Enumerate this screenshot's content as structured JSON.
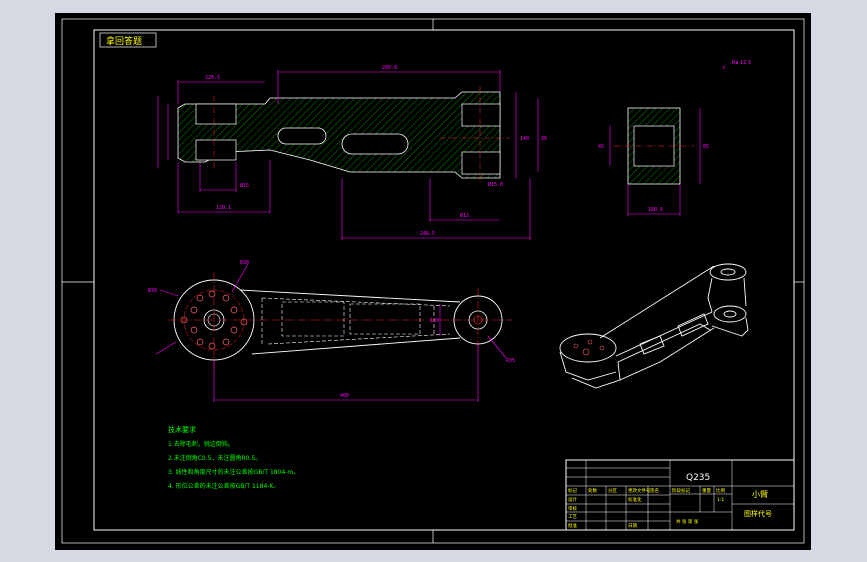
{
  "drawing": {
    "stamp": "拿回答题",
    "material": "Q235",
    "part_name": "小臂",
    "drawing_code": "图样代号",
    "roughness_mark": "Ra 12.5",
    "dims": {
      "top_len": "280.8",
      "overall": "248.5",
      "left_a": "220.5",
      "bot_b": "120.1",
      "hole_d1": "Ø12",
      "hole_d2": "Ø15",
      "right_h": "140",
      "right_h2": "30",
      "bot_c": "Ø15.8",
      "sec_w": "180.5",
      "sec_h": "85",
      "sec_h2": "45",
      "plan_len": "400",
      "plan_w": "120",
      "plan_r": "R30",
      "plan_r2": "R35",
      "plan_d": "Ø30"
    }
  },
  "notes": {
    "title": "技术要求",
    "items": [
      "1.去除毛刺，锐边倒钝。",
      "2.未注倒角C0.5，未注圆角R0.5。",
      "3. 线性和角度尺寸的未注公差按GB/T 1804-m。",
      "4. 形位公差的未注公差按GB/T 1184-K。"
    ]
  },
  "title_block": {
    "row_labels": [
      "标记",
      "处数",
      "分区",
      "更改文件号",
      "签名",
      "年月日"
    ],
    "design": "设计",
    "standard": "标准化",
    "check": "审核",
    "process": "工艺",
    "approve": "批准",
    "stage": "阶段标记",
    "weight": "重量",
    "scale": "比例",
    "scale_val": "1:1",
    "sheet": "共 张 第 张",
    "date": "日期"
  }
}
